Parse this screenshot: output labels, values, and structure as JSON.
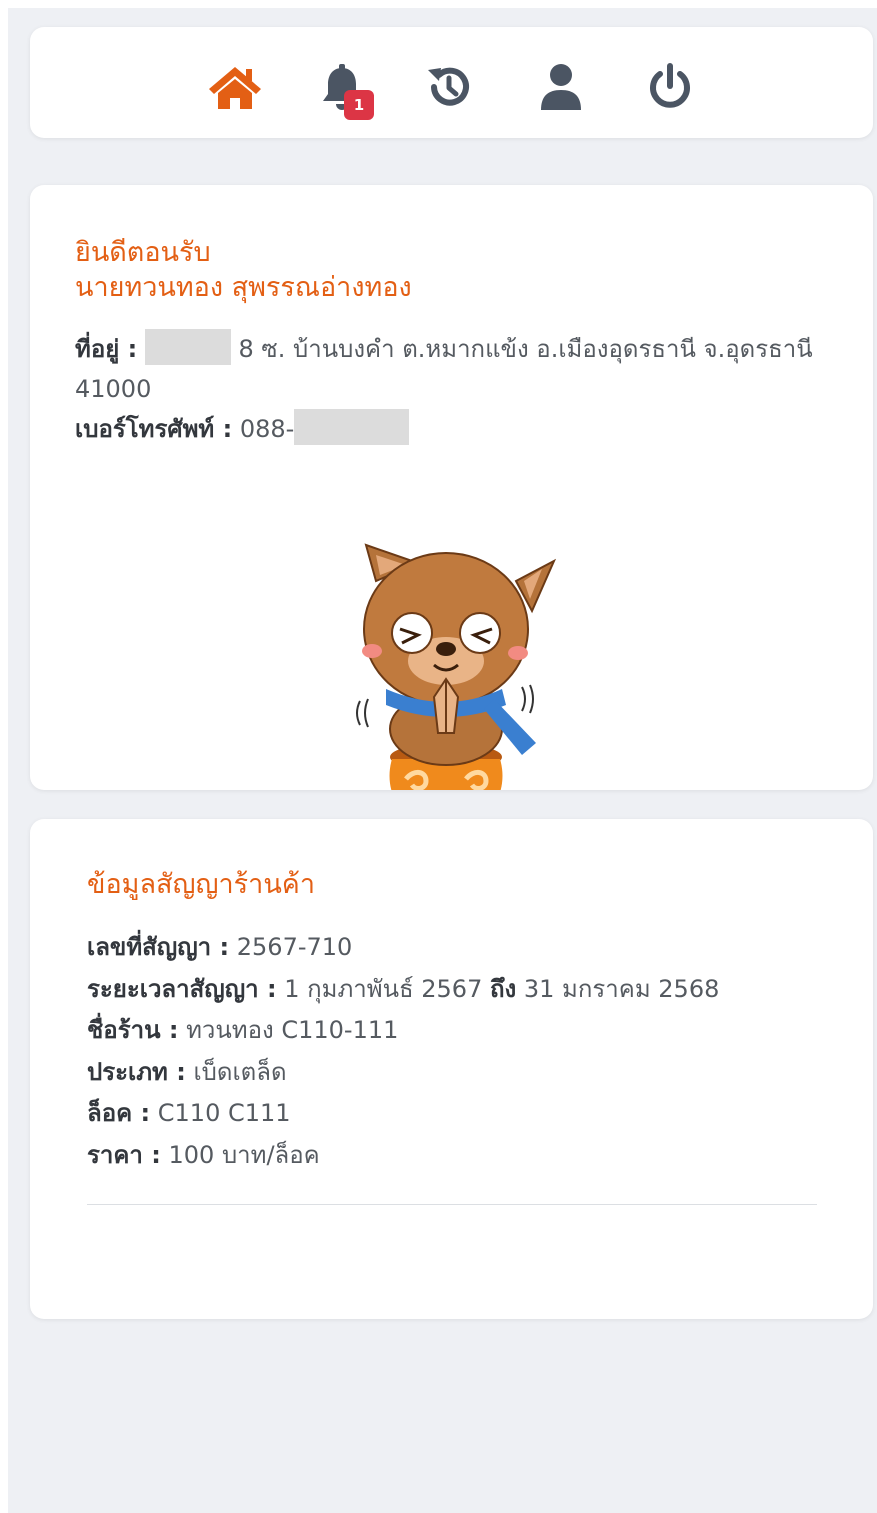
{
  "nav": {
    "items": [
      {
        "name": "home",
        "icon": "home-icon",
        "color": "#e35f14",
        "active": true
      },
      {
        "name": "notifications",
        "icon": "bell-icon",
        "color": "#4b5563",
        "badge": "1"
      },
      {
        "name": "history",
        "icon": "history-icon",
        "color": "#4b5563"
      },
      {
        "name": "profile",
        "icon": "user-icon",
        "color": "#4b5563"
      },
      {
        "name": "logout",
        "icon": "power-icon",
        "color": "#4b5563"
      }
    ],
    "badge_color": "#dc3545"
  },
  "welcome": {
    "greeting": "ยินดีตอนรับ",
    "name": "นายทวนทอง สุพรรณอ่างทอง",
    "address_label": "ที่อยู่ :",
    "address_value": "8 ซ. บ้านบงคำ ต.หมากแข้ง อ.เมืองอุดรธานี จ.อุดรธานี 41000",
    "phone_label": "เบอร์โทรศัพท์ :",
    "phone_value": "088-"
  },
  "contract": {
    "title": "ข้อมูลสัญญาร้านค้า",
    "number_label": "เลขที่สัญญา :",
    "number_value": "2567-710",
    "period_label": "ระยะเวลาสัญญา :",
    "period_start": "1 กุมภาพันธ์ 2567",
    "period_to": "ถึง",
    "period_end": "31 มกราคม 2568",
    "shop_label": "ชื่อร้าน :",
    "shop_value": "ทวนทอง C110-111",
    "type_label": "ประเภท :",
    "type_value": "เบ็ดเตล็ด",
    "lock_label": "ล็อค :",
    "lock_value": "C110 C111",
    "price_label": "ราคา :",
    "price_value": "100 บาท/ล็อค"
  },
  "colors": {
    "accent": "#e35f14",
    "icon": "#4b5563",
    "background": "#eef0f4"
  }
}
